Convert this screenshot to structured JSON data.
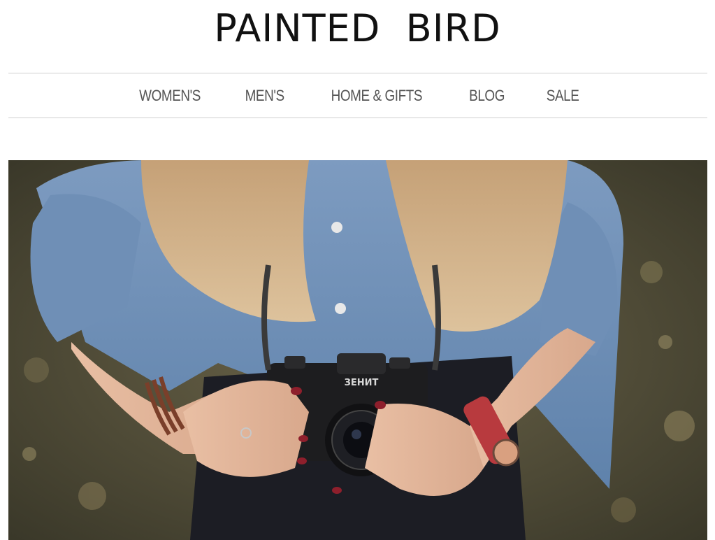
{
  "brand": {
    "name": "PAINTED  BIRD"
  },
  "nav": {
    "items": [
      {
        "label": "WOMEN'S"
      },
      {
        "label": "MEN'S"
      },
      {
        "label": "HOME & GIFTS"
      },
      {
        "label": "BLOG"
      },
      {
        "label": "SALE"
      }
    ]
  },
  "hero": {
    "camera_brand": "ЗЕНИТ"
  },
  "colors": {
    "text": "#111111",
    "nav_text": "#555555",
    "divider": "#cfcfcf",
    "background": "#ffffff"
  }
}
